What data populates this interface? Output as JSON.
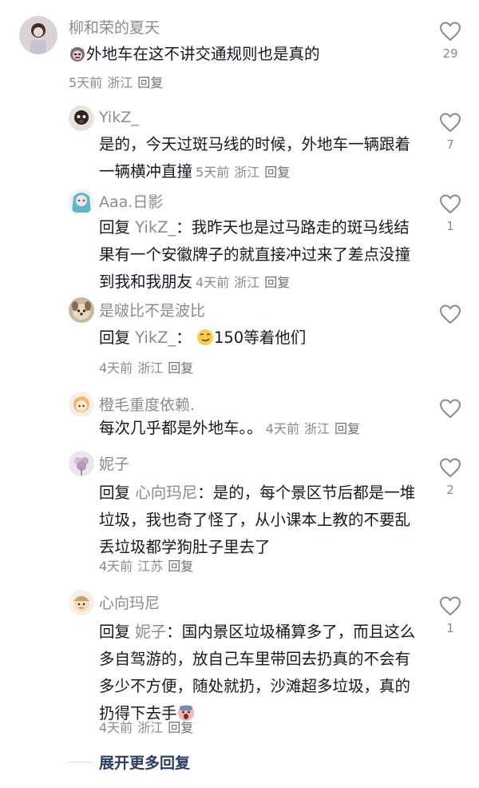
{
  "comments": [
    {
      "user": "柳和荣的夏天",
      "text": "外地车在这不讲交通规则也是真的",
      "time": "5天前",
      "location": "浙江",
      "reply_label": "回复",
      "likes": "29",
      "avatar_icon": "photo-avatar-girl",
      "emoji_icon": "angry-cat-emoji"
    },
    {
      "user": "YikZ_",
      "text": "是的，今天过斑马线的时候，外地车一辆跟着一辆横冲直撞",
      "time": "5天前",
      "location": "浙江",
      "reply_label": "回复",
      "likes": "7",
      "avatar_icon": "photo-avatar-dog"
    },
    {
      "user": "Aaa.日影",
      "reply_prefix": "回复",
      "reply_to": "YikZ_",
      "separator": "：",
      "text": "我昨天也是过马路走的斑马线结果有一个安徽牌子的就直接冲过来了差点没撞到我和我朋友",
      "time": "4天前",
      "location": "浙江",
      "reply_label": "回复",
      "likes": "1",
      "avatar_icon": "anime-avatar"
    },
    {
      "user": "是啵比不是波比",
      "reply_prefix": "回复",
      "reply_to": "YikZ_",
      "separator": "：",
      "text": "150等着他们",
      "time": "4天前",
      "location": "浙江",
      "reply_label": "回复",
      "likes": "",
      "avatar_icon": "dog-avatar",
      "emoji_icon": "smirk-emoji"
    },
    {
      "user": "橙毛重度依赖.",
      "text": "每次几乎都是外地车。。",
      "time": "4天前",
      "location": "浙江",
      "reply_label": "回复",
      "likes": "",
      "avatar_icon": "cartoon-avatar"
    },
    {
      "user": "妮子",
      "reply_prefix": "回复",
      "reply_to": "心向玛尼",
      "separator": "：",
      "text": "是的，每个景区节后都是一堆垃圾，我也奇了怪了，从小课本上教的不要乱丢垃圾都学狗肚子里去了",
      "time": "4天前",
      "location": "江苏",
      "reply_label": "回复",
      "likes": "2",
      "avatar_icon": "flower-avatar"
    },
    {
      "user": "心向玛尼",
      "reply_prefix": "回复",
      "reply_to": "妮子",
      "separator": "：",
      "text": "国内景区垃圾桶算多了，而且这么多自驾游的，放自己车里带回去扔真的不会有多少不方便，随处就扔，沙滩超多垃圾，真的扔得下去手",
      "time": "4天前",
      "location": "浙江",
      "reply_label": "回复",
      "likes": "1",
      "avatar_icon": "cartoon-girl-avatar",
      "emoji_icon": "scream-emoji"
    }
  ],
  "expand_label": "展开更多回复",
  "colors": {
    "text": "#161823",
    "meta": "#8a8b91",
    "expand": "#2b3b63"
  }
}
